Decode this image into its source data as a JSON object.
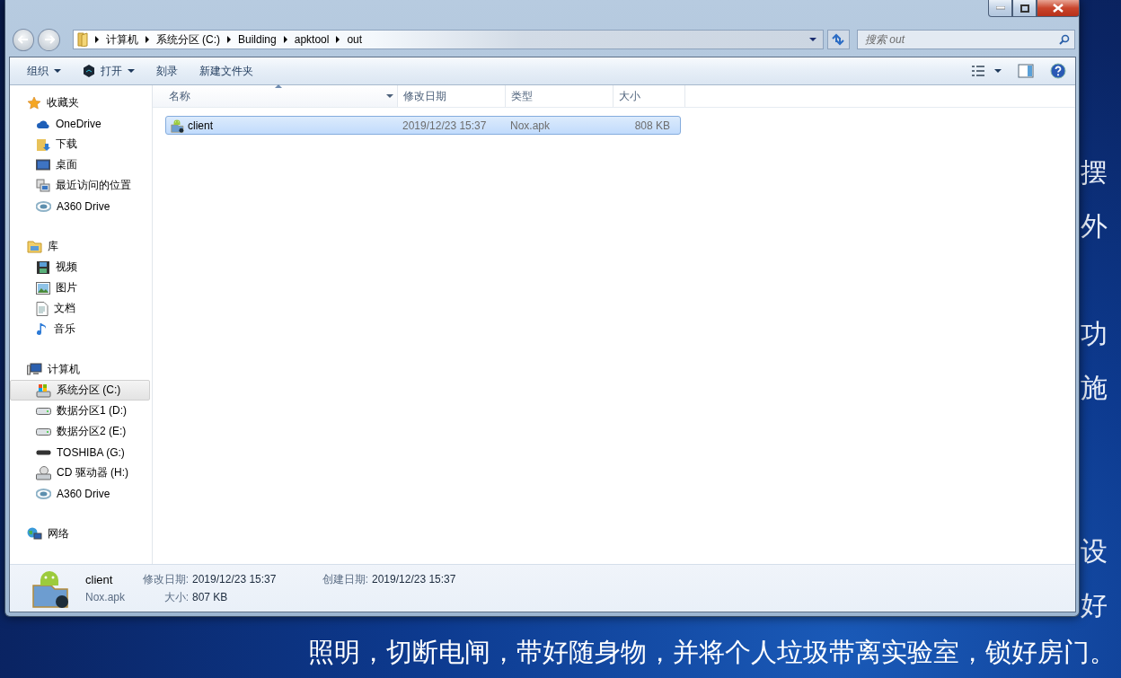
{
  "address": {
    "breadcrumbs": [
      "计算机",
      "系统分区 (C:)",
      "Building",
      "apktool",
      "out"
    ]
  },
  "search": {
    "placeholder": "搜索 out"
  },
  "toolbar": [
    {
      "label": "组织",
      "kind": "dropdown"
    },
    {
      "label": "打开",
      "kind": "app"
    },
    {
      "label": "刻录",
      "kind": "plain"
    },
    {
      "label": "新建文件夹",
      "kind": "plain"
    }
  ],
  "sidebar": [
    {
      "label": "收藏夹",
      "kind": "star",
      "children": [
        {
          "label": "OneDrive",
          "kind": "cloud",
          "selected": false
        },
        {
          "label": "下载",
          "kind": "download",
          "selected": false
        },
        {
          "label": "桌面",
          "kind": "desktop",
          "selected": false
        },
        {
          "label": "最近访问的位置",
          "kind": "recent",
          "selected": false
        },
        {
          "label": "A360 Drive",
          "kind": "swirl",
          "selected": false
        }
      ]
    },
    {
      "label": "库",
      "kind": "library",
      "children": [
        {
          "label": "视频",
          "kind": "video",
          "selected": false
        },
        {
          "label": "图片",
          "kind": "picture",
          "selected": false
        },
        {
          "label": "文档",
          "kind": "document",
          "selected": false
        },
        {
          "label": "音乐",
          "kind": "music",
          "selected": false
        }
      ]
    },
    {
      "label": "计算机",
      "kind": "computer",
      "children": [
        {
          "label": "系统分区 (C:)",
          "kind": "system",
          "selected": true
        },
        {
          "label": "数据分区1 (D:)",
          "kind": "drive",
          "selected": false
        },
        {
          "label": "数据分区2 (E:)",
          "kind": "drive",
          "selected": false
        },
        {
          "label": "TOSHIBA (G:)",
          "kind": "removable",
          "selected": false
        },
        {
          "label": "CD 驱动器 (H:)",
          "kind": "cd",
          "selected": false
        },
        {
          "label": "A360 Drive",
          "kind": "swirl",
          "selected": false
        }
      ]
    },
    {
      "label": "网络",
      "kind": "network"
    }
  ],
  "columns": [
    {
      "label": "名称",
      "sorted": true
    },
    {
      "label": "修改日期",
      "sorted": false
    },
    {
      "label": "类型",
      "sorted": false
    },
    {
      "label": "大小",
      "sorted": false
    }
  ],
  "rows": [
    {
      "name": "client",
      "date": "2019/12/23 15:37",
      "type": "Nox.apk",
      "size": "808 KB",
      "selected": true
    }
  ],
  "details": {
    "name": "client",
    "type": "Nox.apk",
    "fields": [
      {
        "label": "修改日期:",
        "value": "2019/12/23 15:37"
      },
      {
        "label": "创建日期:",
        "value": "2019/12/23 15:37"
      },
      {
        "label": "大小:",
        "value": "807 KB"
      }
    ]
  },
  "desktop": {
    "side_fragments": [
      "摆",
      "外",
      "功",
      "施",
      "设",
      "好"
    ],
    "caption": "照明，切断电闸，带好随身物，并将个人垃圾带离实验室，锁好房门。"
  }
}
